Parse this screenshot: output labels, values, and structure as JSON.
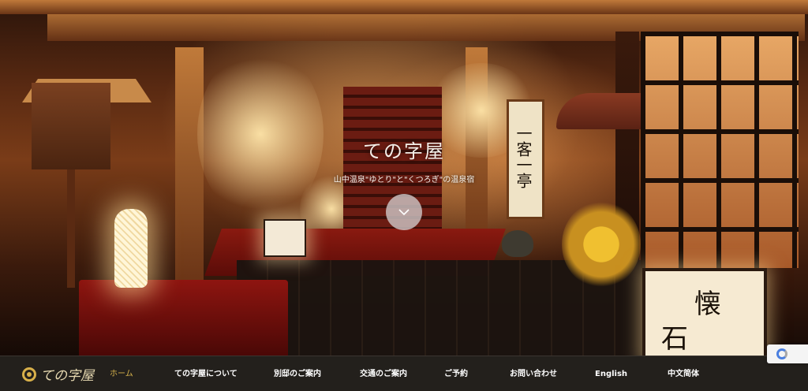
{
  "hero": {
    "title": "ての字屋",
    "subtitle": "山中温泉\"ゆとり\"と\"くつろぎ\"の温泉宿",
    "scroll_icon": "chevron-down-icon",
    "scroll_button_bg": "#cdc3c3"
  },
  "photo": {
    "scroll_text": "一客一亭",
    "sign_chars": [
      "懐",
      "石"
    ]
  },
  "logo": {
    "text": "ての字屋",
    "icon": "circle-logo-icon",
    "color": "#d8b04a"
  },
  "nav": {
    "home": "ホーム",
    "about": "ての字屋について",
    "annex": "別邸のご案内",
    "access": "交通のご案内",
    "booking": "ご予約",
    "contact": "お問い合わせ",
    "english": "English",
    "chinese": "中文简体",
    "active_color": "#d4b04a",
    "bar_color": "#23201c"
  },
  "widgets": {
    "recaptcha_icon": "recaptcha-icon"
  }
}
